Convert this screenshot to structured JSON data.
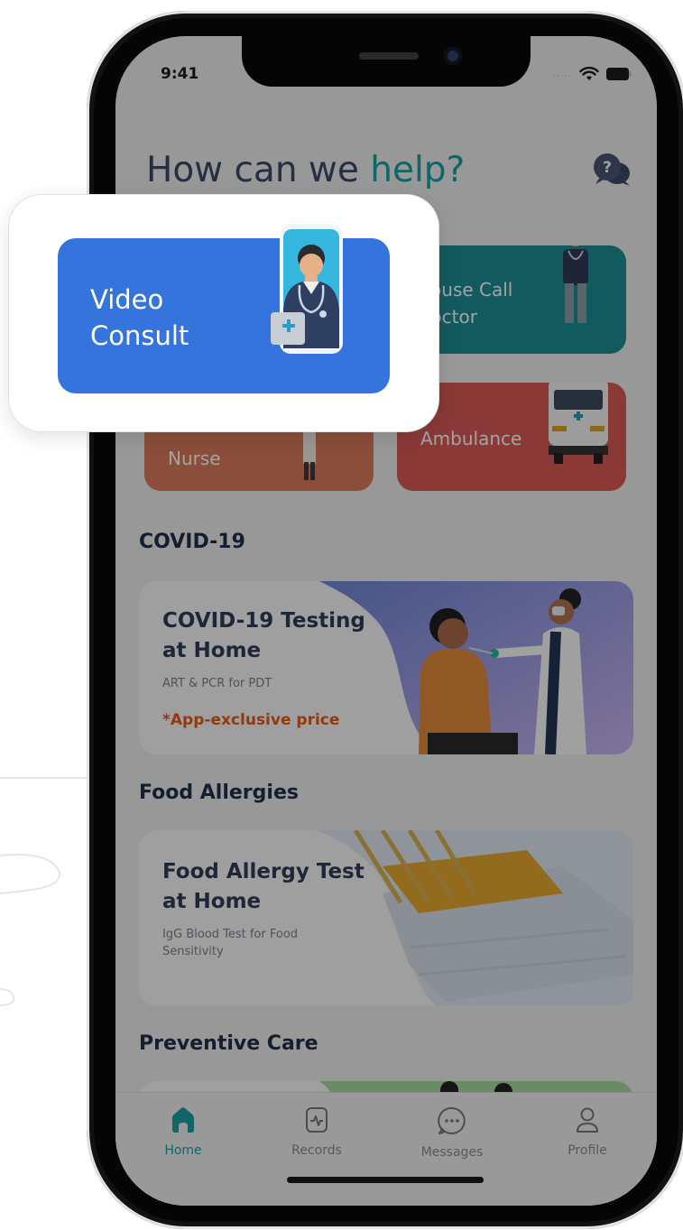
{
  "status_bar": {
    "time": "9:41",
    "signal_dots": "....."
  },
  "header": {
    "title_prefix": "How can we ",
    "title_accent": "help?"
  },
  "services": {
    "video_consult": "Video\nConsult",
    "house_call": "House Call\nDoctor",
    "nurse": "Nurse",
    "ambulance": "Ambulance"
  },
  "sections": {
    "covid": {
      "title": "COVID-19",
      "card_title": "COVID-19 Testing at Home",
      "card_subtitle": "ART & PCR for PDT",
      "card_price": "*App-exclusive price"
    },
    "food": {
      "title": "Food Allergies",
      "card_title": "Food Allergy Test at Home",
      "card_subtitle": "IgG Blood Test for Food Sensitivity"
    },
    "preventive": {
      "title": "Preventive Care"
    }
  },
  "tabs": [
    {
      "label": "Home",
      "active": true
    },
    {
      "label": "Records",
      "active": false
    },
    {
      "label": "Messages",
      "active": false
    },
    {
      "label": "Profile",
      "active": false
    }
  ],
  "colors": {
    "accent": "#1aa0a0",
    "video_consult": "#3574dc",
    "house_call": "#1f8e95",
    "nurse": "#d97a5c",
    "ambulance": "#d95a55",
    "price": "#e25c18"
  }
}
